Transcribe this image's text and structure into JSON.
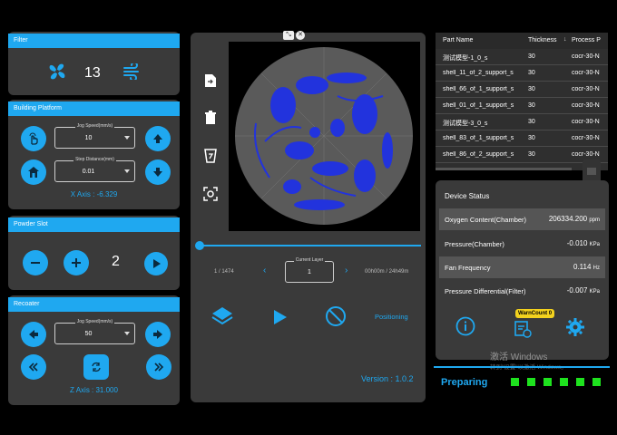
{
  "filter": {
    "header": "Filter",
    "value": "13"
  },
  "building": {
    "header": "Building Platform",
    "jog_label": "Jog Speed(mm/s)",
    "jog_value": "10",
    "step_label": "Step Distance(mm)",
    "step_value": "0.01",
    "axis": "X Axis : -6.329"
  },
  "powder": {
    "header": "Powder Slot",
    "value": "2"
  },
  "recoater": {
    "header": "Recoater",
    "jog_label": "Jog Speed(mm/s)",
    "jog_value": "50",
    "axis": "Z Axis : 31.000"
  },
  "viewer": {
    "layer_count": "1 / 1474",
    "current_layer_label": "Current Layer",
    "current_layer": "1",
    "time": "00h00m / 24h49m",
    "positioning": "Positioning",
    "version": "Version : 1.0.2",
    "progress": 0.0
  },
  "parts_table": {
    "columns": [
      "Part Name",
      "Thickness",
      "Process P"
    ],
    "rows": [
      [
        "测试模型-1_0_s",
        "30",
        "cocr-30-N"
      ],
      [
        "shell_11_of_2_support_s",
        "30",
        "cocr-30-N"
      ],
      [
        "shell_66_of_1_support_s",
        "30",
        "cocr-30-N"
      ],
      [
        "shell_01_of_1_support_s",
        "30",
        "cocr-30-N"
      ],
      [
        "测试模型-3_0_s",
        "30",
        "cocr-30-N"
      ],
      [
        "shell_83_of_1_support_s",
        "30",
        "cocr-30-N"
      ],
      [
        "shell_86_of_2_support_s",
        "30",
        "cocr-30-N"
      ]
    ]
  },
  "device": {
    "title": "Device Status",
    "items": [
      {
        "label": "Oxygen Content(Chamber)",
        "value": "206334.200",
        "unit": "ppm"
      },
      {
        "label": "Pressure(Chamber)",
        "value": "-0.010",
        "unit": "KPa"
      },
      {
        "label": "Fan Frequency",
        "value": "0.114",
        "unit": "Hz"
      },
      {
        "label": "Pressure Differential(Filter)",
        "value": "-0.007",
        "unit": "KPa"
      }
    ],
    "warn": "WarnCount 0"
  },
  "watermark": {
    "line1": "激活 Windows",
    "line2": "转到\"设置\"以激活 Windows。"
  },
  "status": {
    "text": "Preparing"
  },
  "colors": {
    "accent": "#1fa8f0",
    "panel": "#3a3a3a",
    "ok": "#1ee21e",
    "parts": "#2233dd"
  }
}
